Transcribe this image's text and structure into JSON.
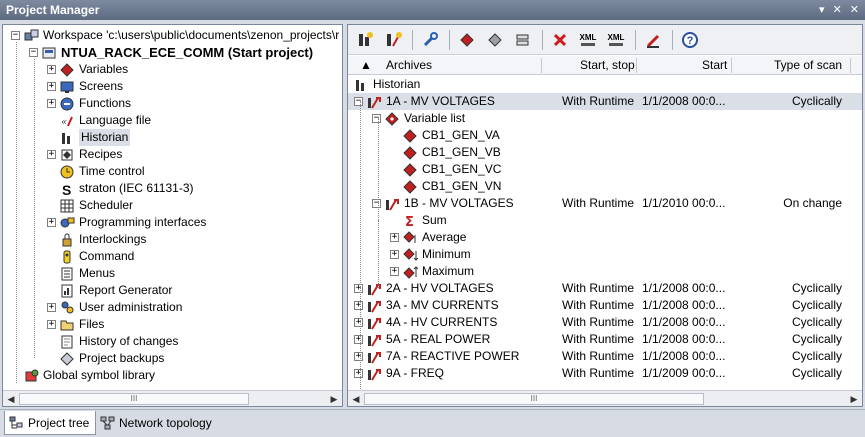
{
  "window": {
    "title": "Project Manager",
    "controls": [
      "▾",
      "✕",
      "✕"
    ]
  },
  "tree": {
    "workspace": "Workspace 'c:\\users\\public\\documents\\zenon_projects\\r",
    "project": "NTUA_RACK_ECE_COMM (Start project)",
    "items": [
      {
        "label": "Variables",
        "icon": "variables-icon",
        "expandable": true
      },
      {
        "label": "Screens",
        "icon": "screens-icon",
        "expandable": true
      },
      {
        "label": "Functions",
        "icon": "functions-icon",
        "expandable": true
      },
      {
        "label": "Language file",
        "icon": "language-file-icon",
        "expandable": false
      },
      {
        "label": "Historian",
        "icon": "historian-icon",
        "expandable": false,
        "selected": true
      },
      {
        "label": "Recipes",
        "icon": "recipes-icon",
        "expandable": true
      },
      {
        "label": "Time control",
        "icon": "time-control-icon",
        "expandable": false
      },
      {
        "label": "straton (IEC 61131-3)",
        "icon": "straton-icon",
        "expandable": false
      },
      {
        "label": "Scheduler",
        "icon": "scheduler-icon",
        "expandable": false
      },
      {
        "label": "Programming interfaces",
        "icon": "programming-interfaces-icon",
        "expandable": true
      },
      {
        "label": "Interlockings",
        "icon": "interlockings-icon",
        "expandable": false
      },
      {
        "label": "Command",
        "icon": "command-icon",
        "expandable": false
      },
      {
        "label": "Menus",
        "icon": "menus-icon",
        "expandable": false
      },
      {
        "label": "Report Generator",
        "icon": "report-generator-icon",
        "expandable": false
      },
      {
        "label": "User administration",
        "icon": "user-administration-icon",
        "expandable": true
      },
      {
        "label": "Files",
        "icon": "files-icon",
        "expandable": true
      },
      {
        "label": "History of changes",
        "icon": "history-of-changes-icon",
        "expandable": false
      },
      {
        "label": "Project backups",
        "icon": "project-backups-icon",
        "expandable": false
      }
    ],
    "global": "Global symbol library"
  },
  "toolbar": {
    "buttons": [
      "new-archive-icon",
      "new-sub-archive-icon",
      "settings-wrench-icon",
      "export-icon",
      "import-icon",
      "duplicate-icon",
      "delete-icon",
      "xml-export-icon",
      "xml-import-icon",
      "edit-icon",
      "help-icon"
    ],
    "xml1": "XML",
    "xml2": "XML"
  },
  "columns": {
    "archives": "Archives",
    "start_stop": "Start, stop",
    "start": "Start",
    "type_of_scan": "Type of scan"
  },
  "grid": {
    "root": "Historian",
    "rows": [
      {
        "level": 0,
        "name": "1A - MV VOLTAGES",
        "start_stop": "With Runtime",
        "start": "1/1/2008 00:0...",
        "scan": "Cyclically",
        "exp": "−",
        "selected": true
      },
      {
        "level": 1,
        "name": "Variable list",
        "start_stop": "",
        "start": "",
        "scan": "",
        "exp": "−"
      },
      {
        "level": 2,
        "name": "CB1_GEN_VA",
        "start_stop": "",
        "start": "",
        "scan": "",
        "exp": ""
      },
      {
        "level": 2,
        "name": "CB1_GEN_VB",
        "start_stop": "",
        "start": "",
        "scan": "",
        "exp": ""
      },
      {
        "level": 2,
        "name": "CB1_GEN_VC",
        "start_stop": "",
        "start": "",
        "scan": "",
        "exp": ""
      },
      {
        "level": 2,
        "name": "CB1_GEN_VN",
        "start_stop": "",
        "start": "",
        "scan": "",
        "exp": ""
      },
      {
        "level": 1,
        "name": "1B - MV VOLTAGES",
        "start_stop": "With Runtime",
        "start": "1/1/2010 00:0...",
        "scan": "On change",
        "exp": "−"
      },
      {
        "level": 2,
        "name": "Sum",
        "start_stop": "",
        "start": "",
        "scan": "",
        "exp": ""
      },
      {
        "level": 2,
        "name": "Average",
        "start_stop": "",
        "start": "",
        "scan": "",
        "exp": "+"
      },
      {
        "level": 2,
        "name": "Minimum",
        "start_stop": "",
        "start": "",
        "scan": "",
        "exp": "+"
      },
      {
        "level": 2,
        "name": "Maximum",
        "start_stop": "",
        "start": "",
        "scan": "",
        "exp": "+"
      },
      {
        "level": 0,
        "name": "2A - HV VOLTAGES",
        "start_stop": "With Runtime",
        "start": "1/1/2008 00:0...",
        "scan": "Cyclically",
        "exp": "+"
      },
      {
        "level": 0,
        "name": "3A - MV CURRENTS",
        "start_stop": "With Runtime",
        "start": "1/1/2008 00:0...",
        "scan": "Cyclically",
        "exp": "+"
      },
      {
        "level": 0,
        "name": "4A - HV CURRENTS",
        "start_stop": "With Runtime",
        "start": "1/1/2008 00:0...",
        "scan": "Cyclically",
        "exp": "+"
      },
      {
        "level": 0,
        "name": "5A - REAL POWER",
        "start_stop": "With Runtime",
        "start": "1/1/2008 00:0...",
        "scan": "Cyclically",
        "exp": "+"
      },
      {
        "level": 0,
        "name": "7A - REACTIVE POWER",
        "start_stop": "With Runtime",
        "start": "1/1/2008 00:0...",
        "scan": "Cyclically",
        "exp": "+"
      },
      {
        "level": 0,
        "name": "9A - FREQ",
        "start_stop": "With Runtime",
        "start": "1/1/2009 00:0...",
        "scan": "Cyclically",
        "exp": "+"
      }
    ]
  },
  "scroll": {
    "thumb_glyph": "III"
  },
  "tabs": [
    {
      "label": "Project tree",
      "icon": "project-tree-icon",
      "active": true
    },
    {
      "label": "Network topology",
      "icon": "network-topology-icon",
      "active": false
    }
  ]
}
